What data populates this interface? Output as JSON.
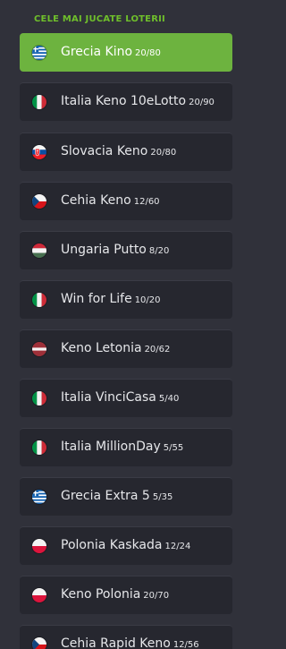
{
  "heading": "CELE MAI JUCATE LOTERII",
  "items": [
    {
      "name": "Grecia Kino",
      "odds": "20/80",
      "flag": "greece-flag-icon",
      "active": true
    },
    {
      "name": "Italia Keno 10eLotto",
      "odds": "20/90",
      "flag": "italy-flag-icon",
      "active": false
    },
    {
      "name": "Slovacia Keno",
      "odds": "20/80",
      "flag": "slovakia-flag-icon",
      "active": false
    },
    {
      "name": "Cehia Keno",
      "odds": "12/60",
      "flag": "czech-flag-icon",
      "active": false
    },
    {
      "name": "Ungaria Putto",
      "odds": "8/20",
      "flag": "hungary-flag-icon",
      "active": false
    },
    {
      "name": "Win for Life",
      "odds": "10/20",
      "flag": "italy-flag-icon",
      "active": false
    },
    {
      "name": "Keno Letonia",
      "odds": "20/62",
      "flag": "latvia-flag-icon",
      "active": false
    },
    {
      "name": "Italia VinciCasa",
      "odds": "5/40",
      "flag": "italy-flag-icon",
      "active": false
    },
    {
      "name": "Italia MillionDay",
      "odds": "5/55",
      "flag": "italy-flag-icon",
      "active": false
    },
    {
      "name": "Grecia Extra 5",
      "odds": "5/35",
      "flag": "greece-flag-icon",
      "active": false
    },
    {
      "name": "Polonia Kaskada",
      "odds": "12/24",
      "flag": "poland-flag-icon",
      "active": false
    },
    {
      "name": "Keno Polonia",
      "odds": "20/70",
      "flag": "poland-flag-icon",
      "active": false
    },
    {
      "name": "Cehia Rapid Keno",
      "odds": "12/56",
      "flag": "czech-flag-icon",
      "active": false
    }
  ],
  "colors": {
    "background": "#30313a",
    "item": "#26272f",
    "active": "#6db33f",
    "heading": "#6fbf2b"
  }
}
